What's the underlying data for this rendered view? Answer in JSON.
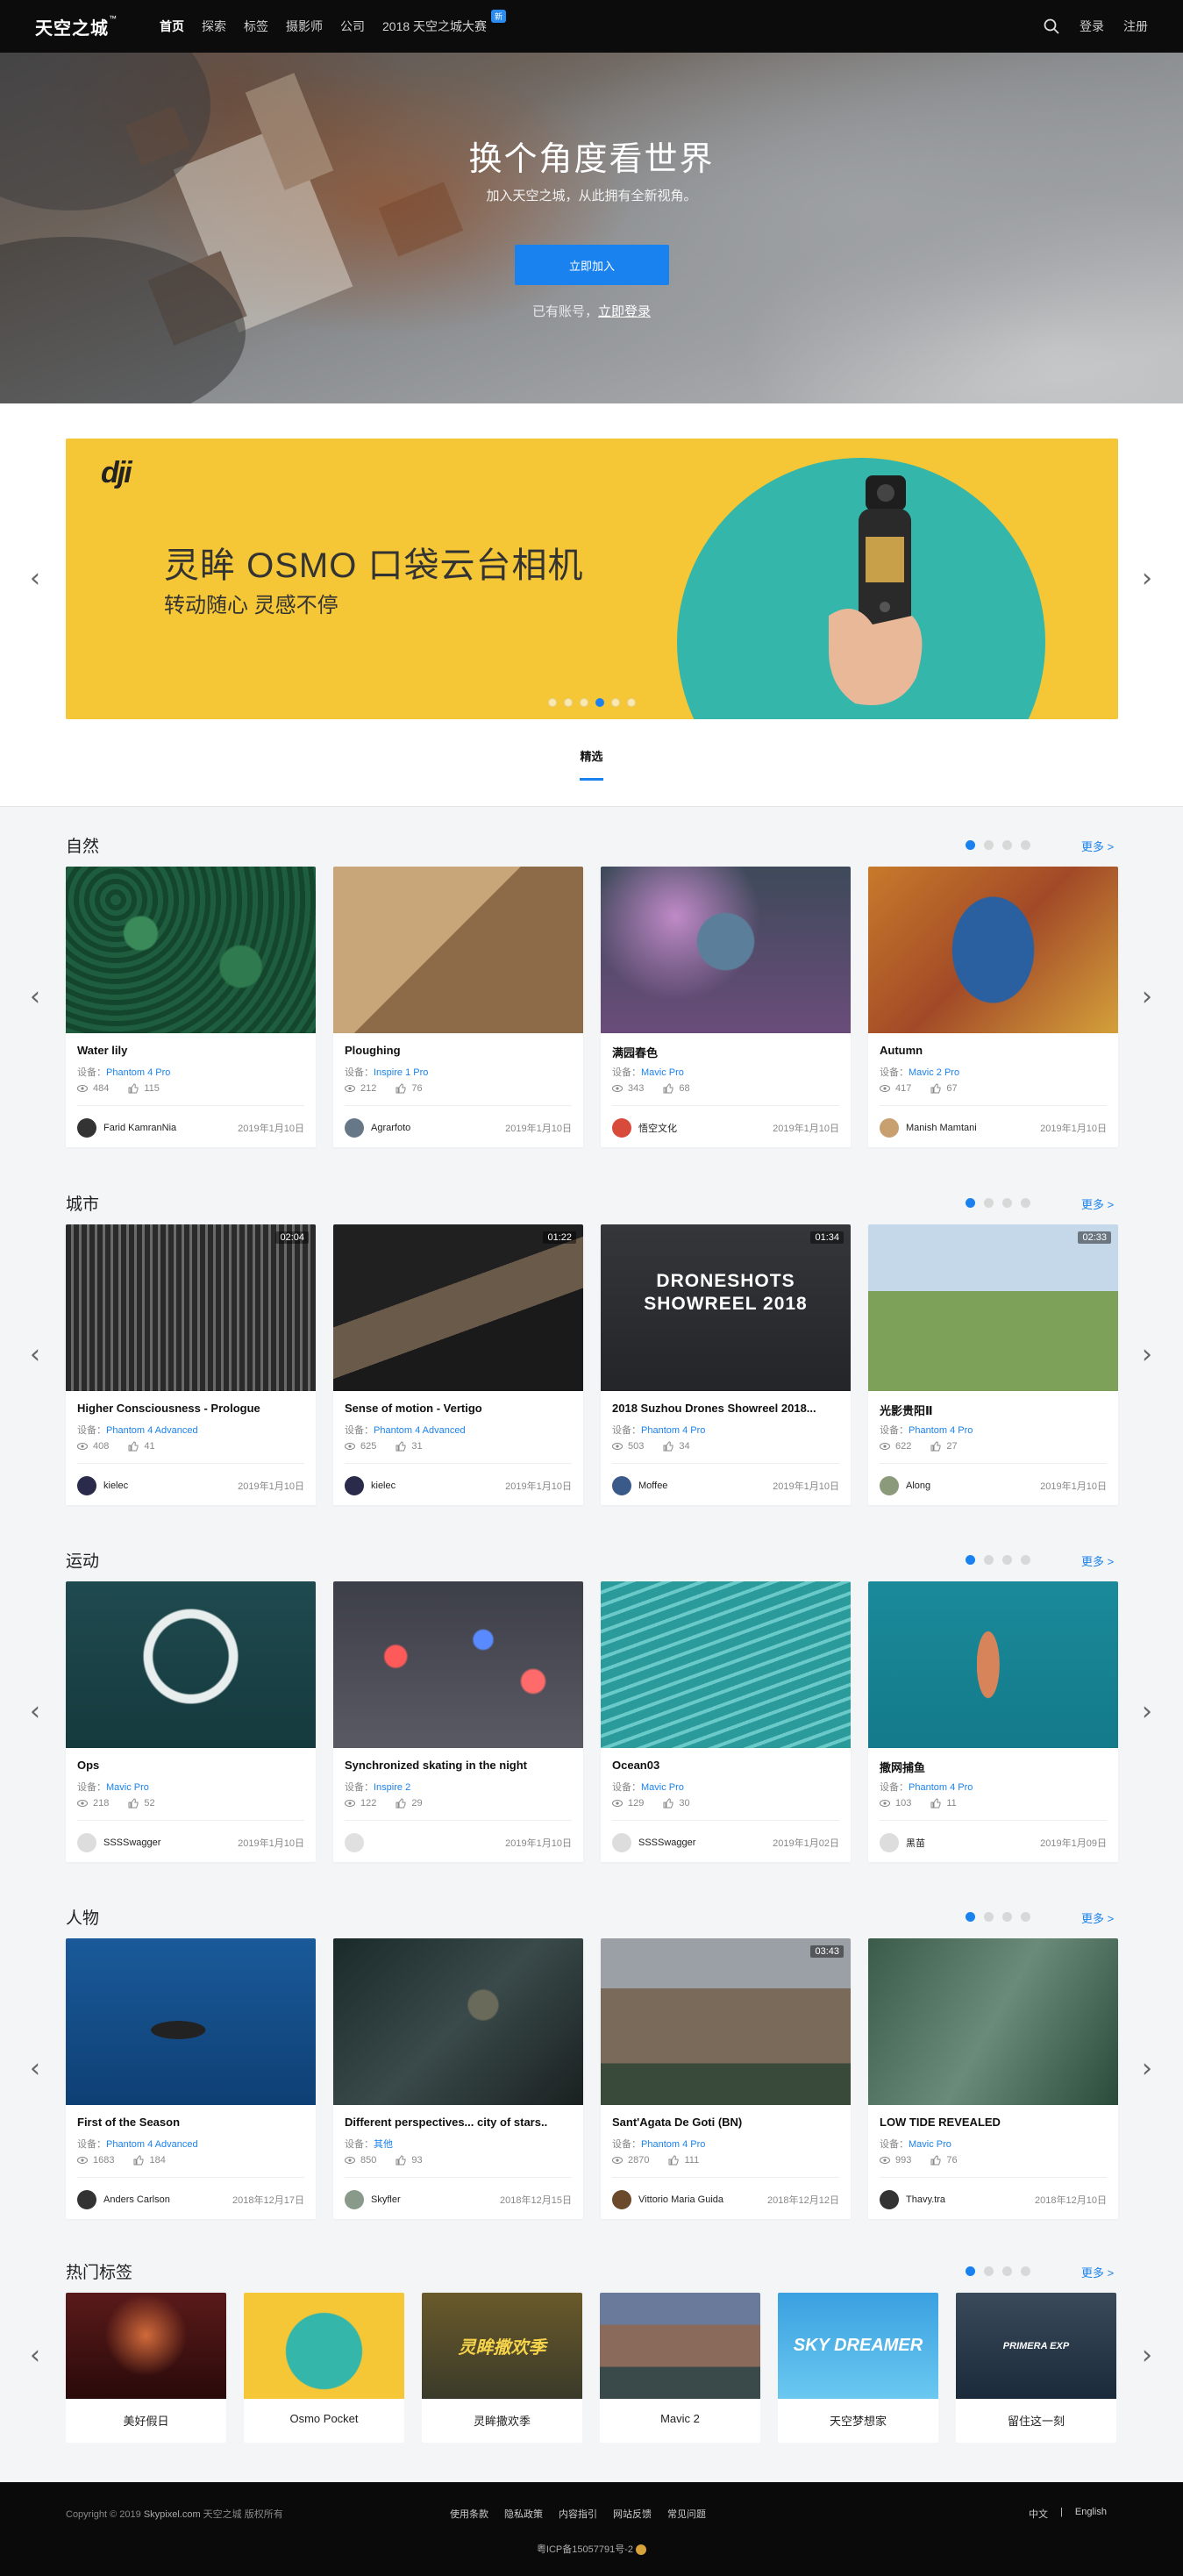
{
  "nav": {
    "logo": "天空之城",
    "logo_tm": "™",
    "items": [
      "首页",
      "探索",
      "标签",
      "摄影师",
      "公司",
      "2018 天空之城大赛"
    ],
    "badge": "新",
    "login": "登录",
    "register": "注册"
  },
  "hero": {
    "title": "换个角度看世界",
    "subtitle": "加入天空之城，从此拥有全新视角。",
    "join": "立即加入",
    "have_account": "已有账号，",
    "login_now": "立即登录"
  },
  "banner": {
    "brand": "dji",
    "title": "灵眸 OSMO 口袋云台相机",
    "subtitle": "转动随心 灵感不停",
    "slide_count": 6,
    "active_slide": 3
  },
  "featured_tab": "精选",
  "more_label": "更多 >",
  "device_prefix": "设备：",
  "sections": [
    {
      "title": "自然",
      "cards": [
        {
          "title": "Water lily",
          "device": "Phantom 4 Pro",
          "views": "484",
          "likes": "115",
          "author": "Farid KamranNia",
          "date": "2019年1月10日",
          "duration": ""
        },
        {
          "title": "Ploughing",
          "device": "Inspire 1 Pro",
          "views": "212",
          "likes": "76",
          "author": "Agrarfoto",
          "date": "2019年1月10日",
          "duration": ""
        },
        {
          "title": "满园春色",
          "device": "Mavic Pro",
          "views": "343",
          "likes": "68",
          "author": "悟空文化",
          "date": "2019年1月10日",
          "duration": ""
        },
        {
          "title": "Autumn",
          "device": "Mavic 2 Pro",
          "views": "417",
          "likes": "67",
          "author": "Manish Mamtani",
          "date": "2019年1月10日",
          "duration": ""
        }
      ]
    },
    {
      "title": "城市",
      "cards": [
        {
          "title": "Higher Consciousness - Prologue",
          "device": "Phantom 4 Advanced",
          "views": "408",
          "likes": "41",
          "author": "kielec",
          "date": "2019年1月10日",
          "duration": "02:04"
        },
        {
          "title": "Sense of motion - Vertigo",
          "device": "Phantom 4 Advanced",
          "views": "625",
          "likes": "31",
          "author": "kielec",
          "date": "2019年1月10日",
          "duration": "01:22"
        },
        {
          "title": "2018 Suzhou Drones Showreel 2018...",
          "device": "Phantom 4 Pro",
          "views": "503",
          "likes": "34",
          "author": "Moffee",
          "date": "2019年1月10日",
          "duration": "01:34",
          "overlay": "DRONESHOTS SHOWREEL 2018"
        },
        {
          "title": "光影贵阳Ⅱ",
          "device": "Phantom 4 Pro",
          "views": "622",
          "likes": "27",
          "author": "Along",
          "date": "2019年1月10日",
          "duration": "02:33"
        }
      ]
    },
    {
      "title": "运动",
      "cards": [
        {
          "title": "Ops",
          "device": "Mavic Pro",
          "views": "218",
          "likes": "52",
          "author": "SSSSwagger",
          "date": "2019年1月10日",
          "duration": ""
        },
        {
          "title": "Synchronized skating in the night",
          "device": "Inspire 2",
          "views": "122",
          "likes": "29",
          "author": "",
          "date": "2019年1月10日",
          "duration": ""
        },
        {
          "title": "Ocean03",
          "device": "Mavic Pro",
          "views": "129",
          "likes": "30",
          "author": "SSSSwagger",
          "date": "2019年1月02日",
          "duration": ""
        },
        {
          "title": "撒网捕鱼",
          "device": "Phantom 4 Pro",
          "views": "103",
          "likes": "11",
          "author": "黑苗",
          "date": "2019年1月09日",
          "duration": ""
        }
      ]
    },
    {
      "title": "人物",
      "cards": [
        {
          "title": "First of the Season",
          "device": "Phantom 4 Advanced",
          "views": "1683",
          "likes": "184",
          "author": "Anders Carlson",
          "date": "2018年12月17日",
          "duration": ""
        },
        {
          "title": "Different perspectives... city of stars..",
          "device": "其他",
          "views": "850",
          "likes": "93",
          "author": "Skyfler",
          "date": "2018年12月15日",
          "duration": ""
        },
        {
          "title": "Sant'Agata De Goti (BN)",
          "device": "Phantom 4 Pro",
          "views": "2870",
          "likes": "111",
          "author": "Vittorio Maria Guida",
          "date": "2018年12月12日",
          "duration": "03:43"
        },
        {
          "title": "LOW TIDE REVEALED",
          "device": "Mavic Pro",
          "views": "993",
          "likes": "76",
          "author": "Thavy.tra",
          "date": "2018年12月10日",
          "duration": ""
        }
      ]
    }
  ],
  "tags": {
    "title": "热门标签",
    "items": [
      "美好假日",
      "Osmo Pocket",
      "灵眸撒欢季",
      "Mavic 2",
      "天空梦想家",
      "留住这一刻"
    ],
    "overlays": [
      "",
      "",
      "灵眸撒欢季",
      "",
      "SKY DREAMER",
      "PRIMERA EXP"
    ]
  },
  "footer": {
    "copyright": "Copyright © 2019 ",
    "site": "Skypixel.com",
    "rights": " 天空之城 版权所有",
    "links": [
      "使用条款",
      "隐私政策",
      "内容指引",
      "网站反馈",
      "常见问题"
    ],
    "lang_cn": "中文",
    "lang_sep": "|",
    "lang_en": "English",
    "icp": "粤ICP备15057791号-2"
  },
  "colors": {
    "accent": "#1a82ee",
    "nav_bg": "#0c0c0c",
    "banner_yellow": "#f5c635",
    "banner_teal": "#35b6ab"
  }
}
